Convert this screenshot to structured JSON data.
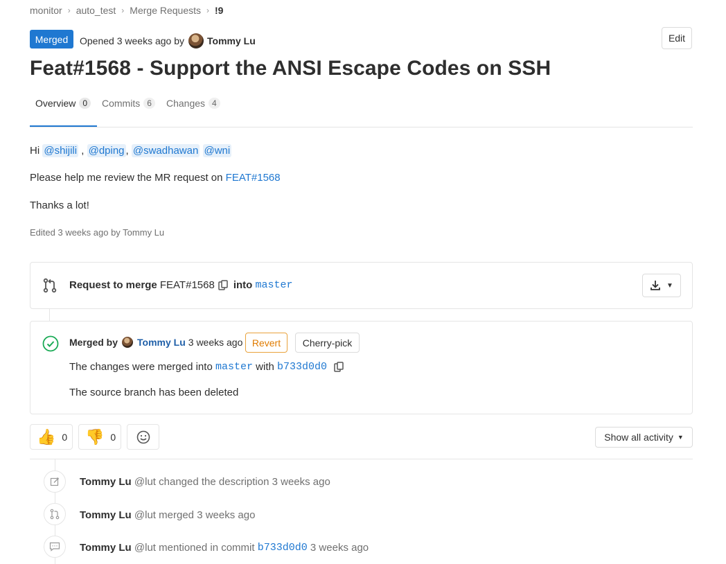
{
  "breadcrumb": {
    "project_group": "monitor",
    "project": "auto_test",
    "section": "Merge Requests",
    "current": "!9"
  },
  "header": {
    "status": "Merged",
    "opened_prefix": "Opened 3 weeks ago by",
    "author": "Tommy Lu",
    "edit_label": "Edit"
  },
  "title": "Feat#1568 - Support the ANSI Escape Codes on SSH",
  "tabs": [
    {
      "label": "Overview",
      "count": "0"
    },
    {
      "label": "Commits",
      "count": "6"
    },
    {
      "label": "Changes",
      "count": "4"
    }
  ],
  "description": {
    "greeting": "Hi",
    "mentions": [
      "@shijili",
      "@dping",
      "@swadhawan",
      "@wni"
    ],
    "review_text": "Please help me review the MR request on",
    "review_link": "FEAT#1568",
    "thanks": "Thanks a lot!",
    "edited": "Edited 3 weeks ago by Tommy Lu"
  },
  "mr_widget": {
    "request_label": "Request to merge",
    "source_branch": "FEAT#1568",
    "into_label": "into",
    "target_branch": "master"
  },
  "merged_panel": {
    "merged_by_label": "Merged by",
    "merger": "Tommy Lu",
    "time": "3 weeks ago",
    "revert_label": "Revert",
    "cherry_pick_label": "Cherry-pick",
    "changes_prefix": "The changes were merged into",
    "target_branch": "master",
    "with_label": "with",
    "commit": "b733d0d0",
    "branch_deleted": "The source branch has been deleted"
  },
  "reactions": {
    "thumbs_up_count": "0",
    "thumbs_down_count": "0"
  },
  "activity_filter": "Show all activity",
  "notes": [
    {
      "author": "Tommy Lu",
      "username": "@lut",
      "action": "changed the description",
      "link": "",
      "time": "3 weeks ago",
      "icon": "pencil-icon"
    },
    {
      "author": "Tommy Lu",
      "username": "@lut",
      "action": "merged",
      "link": "",
      "time": "3 weeks ago",
      "icon": "merge-icon"
    },
    {
      "author": "Tommy Lu",
      "username": "@lut",
      "action": "mentioned in commit",
      "link": "b733d0d0",
      "time": "3 weeks ago",
      "icon": "comment-icon"
    }
  ],
  "colors": {
    "accent": "#1f78d1",
    "merged_green": "#1aaa55",
    "revert_orange": "#e07b00",
    "border": "#e5e5e5"
  }
}
